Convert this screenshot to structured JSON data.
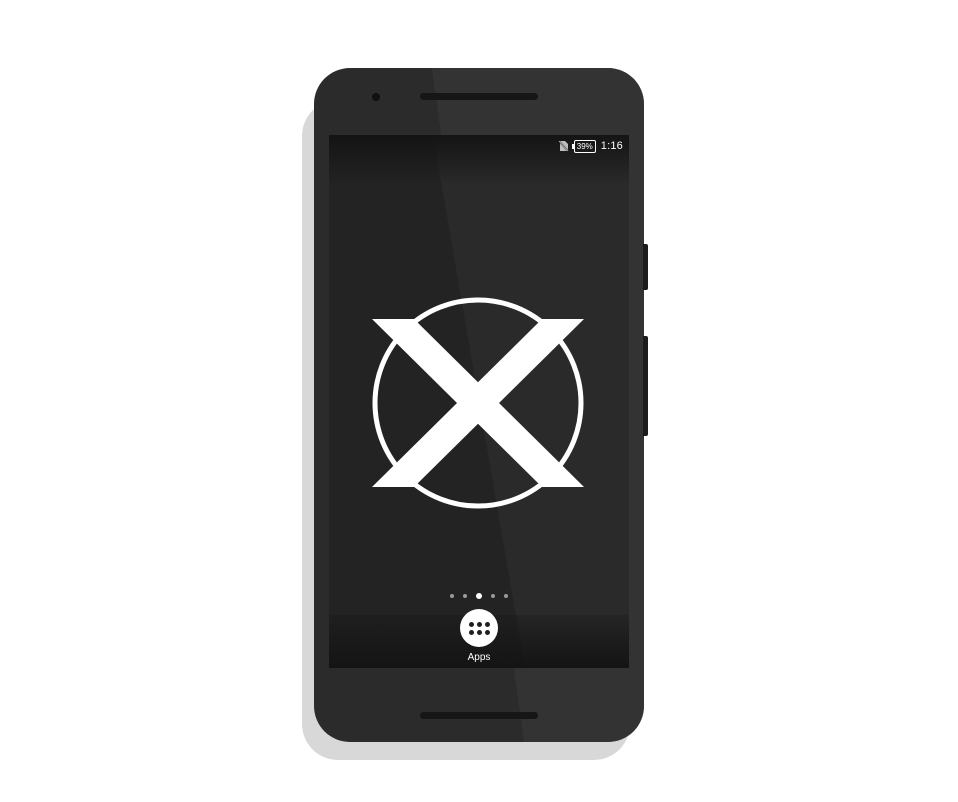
{
  "status_bar": {
    "battery": "39%",
    "time": "1:16",
    "sim_icon": "no-sim-icon"
  },
  "home_screen": {
    "logo_icon": "x-circle-logo-icon",
    "page_count": 5,
    "active_page": 3
  },
  "dock": {
    "apps_label": "Apps",
    "apps_icon": "app-grid-icon"
  },
  "colors": {
    "phone_body": "#2b2b2b",
    "screen_background": "#232323",
    "foreground": "#ffffff"
  }
}
